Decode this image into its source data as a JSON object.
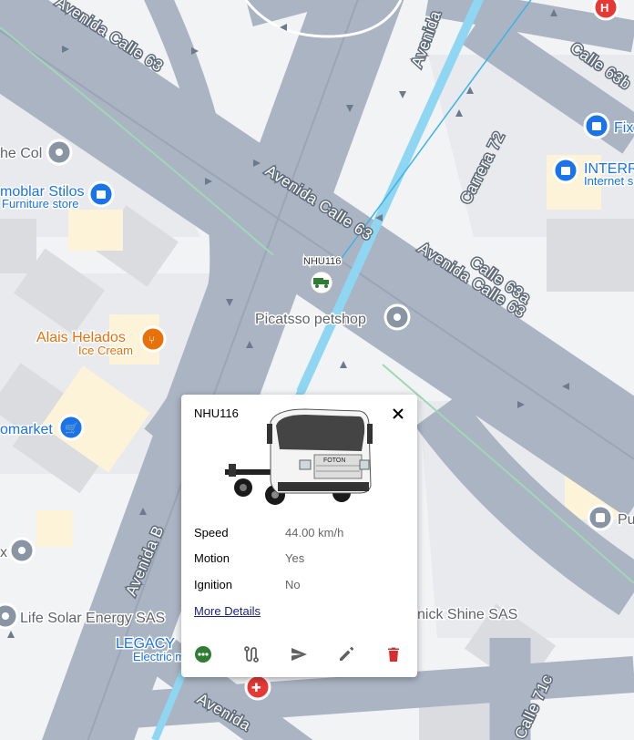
{
  "map": {
    "roads": [
      "Avenida Calle 63",
      "Avenida Calle 63",
      "Avenida Calle 63",
      "Avenida",
      "Carrera 72",
      "Calle 63a",
      "Calle 63b",
      "Avenida B",
      "Avenida",
      "Calle 71c"
    ],
    "pois": [
      {
        "name": "Picatsso petshop",
        "color": "#ffffff",
        "icon": "camera-icon"
      },
      {
        "name": "Alais Helados",
        "sub": "Ice Cream",
        "color": "#e8710a",
        "icon": "food-icon"
      },
      {
        "name": "moblar Stilos",
        "sub": "Furniture store",
        "color": "#1a73e8",
        "icon": "shopping-bag-icon"
      },
      {
        "name": "INTERR",
        "sub": "Internet s",
        "color": "#1a73e8",
        "icon": "shopping-bag-icon"
      },
      {
        "name": "Fix",
        "color": "#1a73e8",
        "icon": "shopping-bag-icon"
      },
      {
        "name": "he Col",
        "color": "#5f6368",
        "icon": "place-icon"
      },
      {
        "name": "omarket",
        "color": "#1a73e8",
        "icon": "cart-icon"
      },
      {
        "name": "Life Solar Energy SAS",
        "color": "#5f6368",
        "icon": "place-icon"
      },
      {
        "name": "LEGACY",
        "sub": "Electric m",
        "color": "#1a73e8",
        "icon": "shopping-bag-icon"
      },
      {
        "name": "nick Shine SAS",
        "color": "#5f6368",
        "icon": "place-icon"
      },
      {
        "name": "Pu",
        "color": "#5f6368",
        "icon": "bus-icon"
      },
      {
        "name": "x",
        "color": "#5f6368",
        "icon": "place-icon"
      }
    ]
  },
  "vehicle": {
    "marker_label": "NHU116",
    "marker_color": "#2e7d32"
  },
  "popup": {
    "title": "NHU116",
    "close_icon": "close-icon",
    "rows": [
      {
        "label": "Speed",
        "value": "44.00 km/h"
      },
      {
        "label": "Motion",
        "value": "Yes"
      },
      {
        "label": "Ignition",
        "value": "No"
      }
    ],
    "more_details": "More Details",
    "actions": [
      {
        "name": "more-options-button",
        "icon": "more-horiz-icon",
        "color": "#2e7d32"
      },
      {
        "name": "route-button",
        "icon": "route-icon",
        "color": "#616161"
      },
      {
        "name": "send-command-button",
        "icon": "send-icon",
        "color": "#616161"
      },
      {
        "name": "edit-button",
        "icon": "edit-icon",
        "color": "#616161"
      },
      {
        "name": "delete-button",
        "icon": "delete-icon",
        "color": "#d32f2f"
      }
    ]
  }
}
